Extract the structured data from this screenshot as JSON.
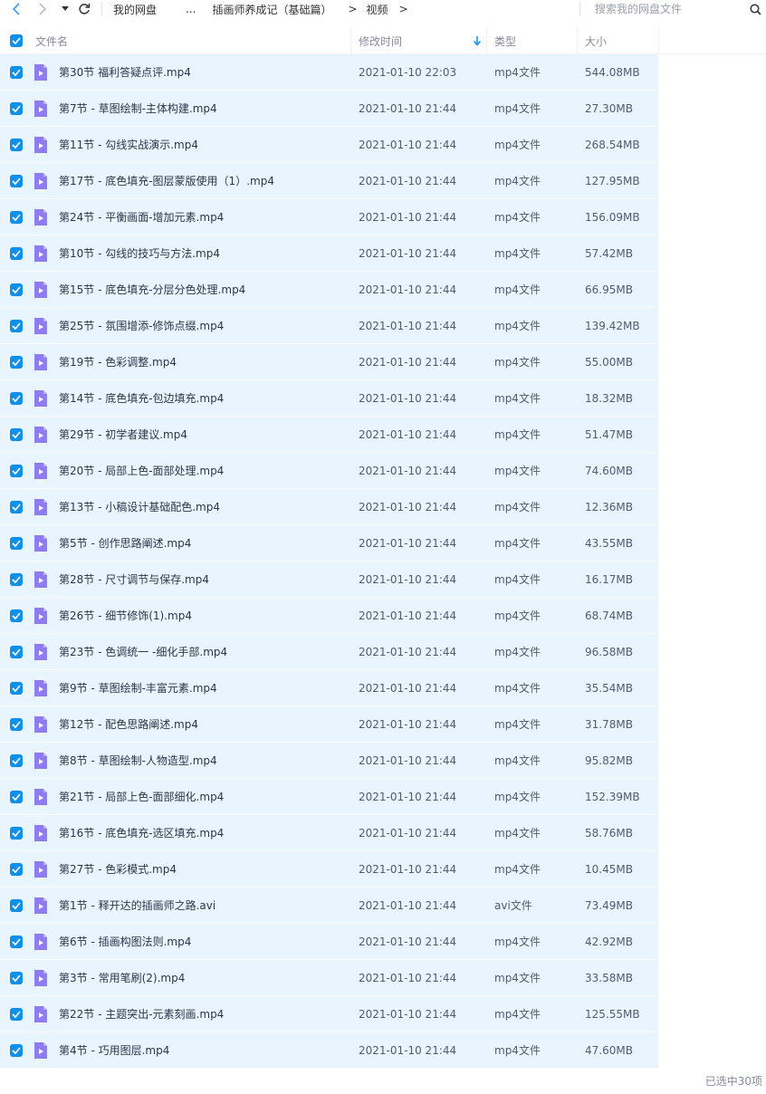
{
  "toolbar": {
    "back_icon": "chevron-left-icon",
    "forward_icon": "chevron-right-icon",
    "dropdown_icon": "caret-down-icon",
    "refresh_icon": "refresh-icon",
    "breadcrumb": [
      {
        "label": "我的网盘"
      },
      {
        "label": "..."
      },
      {
        "label": "插画师养成记（基础篇）"
      },
      {
        "label": "视频"
      }
    ],
    "separator": ">",
    "search_placeholder": "搜索我的网盘文件",
    "search_icon": "search-icon"
  },
  "header": {
    "name": "文件名",
    "modified": "修改时间",
    "type": "类型",
    "size": "大小",
    "sort_icon": "arrow-down-icon"
  },
  "files": [
    {
      "name": "第30节 福利答疑点评.mp4",
      "modified": "2021-01-10 22:03",
      "type": "mp4文件",
      "size": "544.08MB",
      "checked": true
    },
    {
      "name": "第7节 - 草图绘制-主体构建.mp4",
      "modified": "2021-01-10 21:44",
      "type": "mp4文件",
      "size": "27.30MB",
      "checked": true
    },
    {
      "name": "第11节 - 勾线实战演示.mp4",
      "modified": "2021-01-10 21:44",
      "type": "mp4文件",
      "size": "268.54MB",
      "checked": true
    },
    {
      "name": "第17节 - 底色填充-图层蒙版使用（1）.mp4",
      "modified": "2021-01-10 21:44",
      "type": "mp4文件",
      "size": "127.95MB",
      "checked": true
    },
    {
      "name": "第24节 - 平衡画面-增加元素.mp4",
      "modified": "2021-01-10 21:44",
      "type": "mp4文件",
      "size": "156.09MB",
      "checked": true
    },
    {
      "name": "第10节 - 勾线的技巧与方法.mp4",
      "modified": "2021-01-10 21:44",
      "type": "mp4文件",
      "size": "57.42MB",
      "checked": true
    },
    {
      "name": "第15节 - 底色填充-分层分色处理.mp4",
      "modified": "2021-01-10 21:44",
      "type": "mp4文件",
      "size": "66.95MB",
      "checked": true
    },
    {
      "name": "第25节 - 氛围增添-修饰点缀.mp4",
      "modified": "2021-01-10 21:44",
      "type": "mp4文件",
      "size": "139.42MB",
      "checked": true
    },
    {
      "name": "第19节 - 色彩调整.mp4",
      "modified": "2021-01-10 21:44",
      "type": "mp4文件",
      "size": "55.00MB",
      "checked": true
    },
    {
      "name": "第14节 - 底色填充-包边填充.mp4",
      "modified": "2021-01-10 21:44",
      "type": "mp4文件",
      "size": "18.32MB",
      "checked": true
    },
    {
      "name": "第29节 - 初学者建议.mp4",
      "modified": "2021-01-10 21:44",
      "type": "mp4文件",
      "size": "51.47MB",
      "checked": true
    },
    {
      "name": "第20节 - 局部上色-面部处理.mp4",
      "modified": "2021-01-10 21:44",
      "type": "mp4文件",
      "size": "74.60MB",
      "checked": true
    },
    {
      "name": "第13节 - 小稿设计基础配色.mp4",
      "modified": "2021-01-10 21:44",
      "type": "mp4文件",
      "size": "12.36MB",
      "checked": true
    },
    {
      "name": "第5节 - 创作思路阐述.mp4",
      "modified": "2021-01-10 21:44",
      "type": "mp4文件",
      "size": "43.55MB",
      "checked": true
    },
    {
      "name": "第28节 - 尺寸调节与保存.mp4",
      "modified": "2021-01-10 21:44",
      "type": "mp4文件",
      "size": "16.17MB",
      "checked": true
    },
    {
      "name": "第26节 - 细节修饰(1).mp4",
      "modified": "2021-01-10 21:44",
      "type": "mp4文件",
      "size": "68.74MB",
      "checked": true
    },
    {
      "name": "第23节 - 色调统一 -细化手部.mp4",
      "modified": "2021-01-10 21:44",
      "type": "mp4文件",
      "size": "96.58MB",
      "checked": true
    },
    {
      "name": "第9节 - 草图绘制-丰富元素.mp4",
      "modified": "2021-01-10 21:44",
      "type": "mp4文件",
      "size": "35.54MB",
      "checked": true
    },
    {
      "name": "第12节 - 配色思路阐述.mp4",
      "modified": "2021-01-10 21:44",
      "type": "mp4文件",
      "size": "31.78MB",
      "checked": true
    },
    {
      "name": "第8节 - 草图绘制-人物造型.mp4",
      "modified": "2021-01-10 21:44",
      "type": "mp4文件",
      "size": "95.82MB",
      "checked": true
    },
    {
      "name": "第21节 - 局部上色-面部细化.mp4",
      "modified": "2021-01-10 21:44",
      "type": "mp4文件",
      "size": "152.39MB",
      "checked": true
    },
    {
      "name": "第16节 - 底色填充-选区填充.mp4",
      "modified": "2021-01-10 21:44",
      "type": "mp4文件",
      "size": "58.76MB",
      "checked": true
    },
    {
      "name": "第27节 - 色彩模式.mp4",
      "modified": "2021-01-10 21:44",
      "type": "mp4文件",
      "size": "10.45MB",
      "checked": true
    },
    {
      "name": "第1节 - 释开达的插画师之路.avi",
      "modified": "2021-01-10 21:44",
      "type": "avi文件",
      "size": "73.49MB",
      "checked": true
    },
    {
      "name": "第6节 - 插画构图法则.mp4",
      "modified": "2021-01-10 21:44",
      "type": "mp4文件",
      "size": "42.92MB",
      "checked": true
    },
    {
      "name": "第3节 - 常用笔刷(2).mp4",
      "modified": "2021-01-10 21:44",
      "type": "mp4文件",
      "size": "33.58MB",
      "checked": true
    },
    {
      "name": "第22节 - 主题突出-元素刻画.mp4",
      "modified": "2021-01-10 21:44",
      "type": "mp4文件",
      "size": "125.55MB",
      "checked": true
    },
    {
      "name": "第4节 - 巧用图层.mp4",
      "modified": "2021-01-10 21:44",
      "type": "mp4文件",
      "size": "47.60MB",
      "checked": true
    }
  ],
  "status": {
    "selected_text": "已选中30项"
  },
  "colors": {
    "accent": "#0c90ed",
    "row_selected": "#e8f5fe",
    "video_icon": "#8e7cf0"
  }
}
